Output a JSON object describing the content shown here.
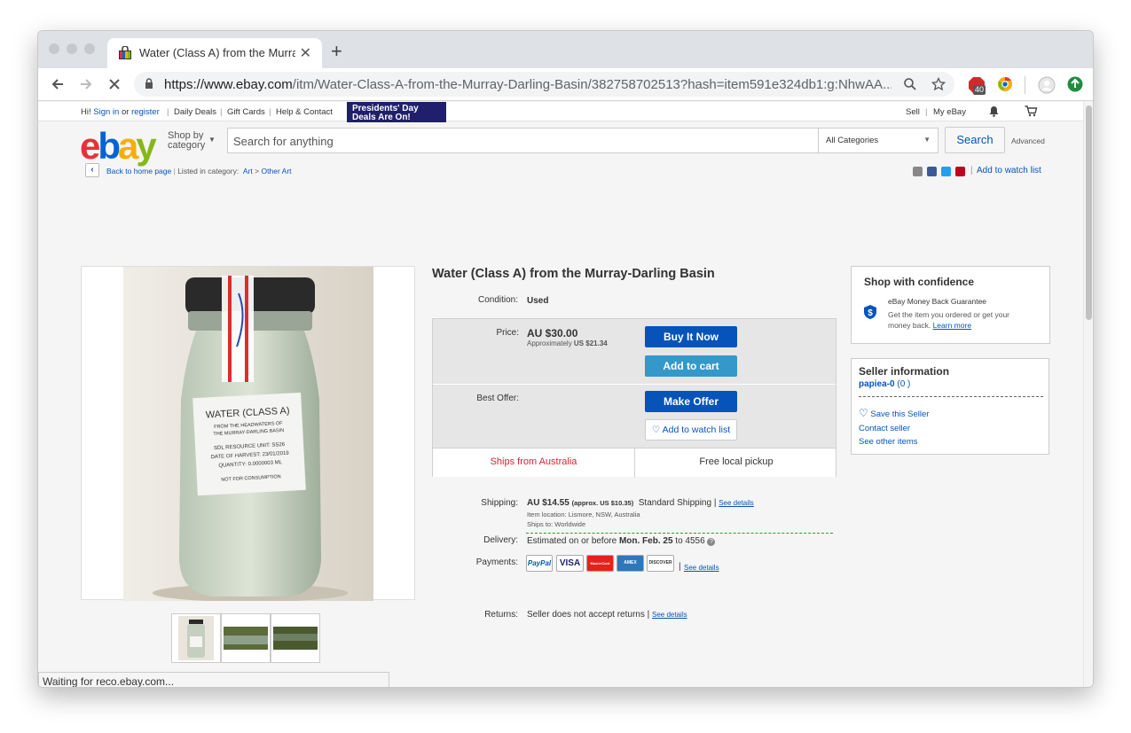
{
  "browser": {
    "tab_title": "Water (Class A) from the Murra",
    "tab_close": "✕",
    "new_tab": "+",
    "url_host": "https://www.ebay.com",
    "url_path": "/itm/Water-Class-A-from-the-Murray-Darling-Basin/382758702513?hash=item591e324db1:g:NhwAA...",
    "ext_badge": "40",
    "status_text": "Waiting for reco.ebay.com..."
  },
  "global_header": {
    "hi": "Hi!",
    "sign_in": "Sign in",
    "or": "or",
    "register": "register",
    "daily_deals": "Daily Deals",
    "gift_cards": "Gift Cards",
    "help_contact": "Help & Contact",
    "promo_line1": "Presidents' Day",
    "promo_line2": "Deals Are On!",
    "sell": "Sell",
    "my_ebay": "My eBay"
  },
  "search": {
    "shop_by_line1": "Shop by",
    "shop_by_line2": "category",
    "placeholder": "Search for anything",
    "category": "All Categories",
    "button": "Search",
    "advanced": "Advanced"
  },
  "breadcrumb": {
    "back": "Back to home page",
    "listed_in": "Listed in category:",
    "cat1": "Art",
    "sep": ">",
    "cat2": "Other Art",
    "add_watch": "Add to watch list"
  },
  "listing": {
    "title": "Water (Class A) from the Murray-Darling Basin",
    "condition_label": "Condition:",
    "condition": "Used",
    "price_label": "Price:",
    "price": "AU $30.00",
    "approx": "Approximately",
    "approx_value": "US $21.34",
    "buy_now": "Buy It Now",
    "add_cart": "Add to cart",
    "best_offer_label": "Best Offer:",
    "make_offer": "Make Offer",
    "add_watch": "Add to watch list",
    "ships_from": "Ships from Australia",
    "pickup": "Free local pickup",
    "shipping_label": "Shipping:",
    "shipping_cost": "AU $14.55",
    "shipping_approx": "(approx. US $10.35)",
    "shipping_method": "Standard Shipping |",
    "see_details": "See details",
    "item_location": "Item location:  Lismore, NSW, Australia",
    "ships_to": "Ships to:  Worldwide",
    "delivery_label": "Delivery:",
    "delivery_prefix": "Estimated on or before",
    "delivery_date": "Mon. Feb. 25",
    "delivery_suffix": "to 4556",
    "payments_label": "Payments:",
    "returns_label": "Returns:",
    "returns_text": "Seller does not accept returns |",
    "payment_methods": [
      "PayPal",
      "VISA",
      "MasterCard",
      "AMEX",
      "DISCOVER"
    ]
  },
  "jar_label": {
    "line1": "WATER (CLASS A)",
    "line2": "FROM THE HEADWATERS OF",
    "line3": "THE MURRAY-DARLING BASIN",
    "line4": "SDL RESOURCE UNIT: SS26",
    "line5": "DATE OF HARVEST: 23/01/2019",
    "line6": "QUANTITY: 0.0000003 ML",
    "line7": "NOT FOR CONSUMPTION"
  },
  "confidence": {
    "title": "Shop with confidence",
    "guarantee": "eBay Money Back Guarantee",
    "desc1": "Get the item you ordered or get your",
    "desc2": "money back.",
    "learn_more": "Learn more"
  },
  "seller": {
    "title": "Seller information",
    "name": "papiea-0",
    "score": "(0 )",
    "save": "Save this Seller",
    "contact": "Contact seller",
    "other": "See other items"
  },
  "colors": {
    "ebay_red": "#e53238",
    "ebay_blue": "#0064d2",
    "ebay_yellow": "#f5af02",
    "ebay_green": "#86b817",
    "button_blue": "#0654ba",
    "button_light": "#3498ca"
  }
}
